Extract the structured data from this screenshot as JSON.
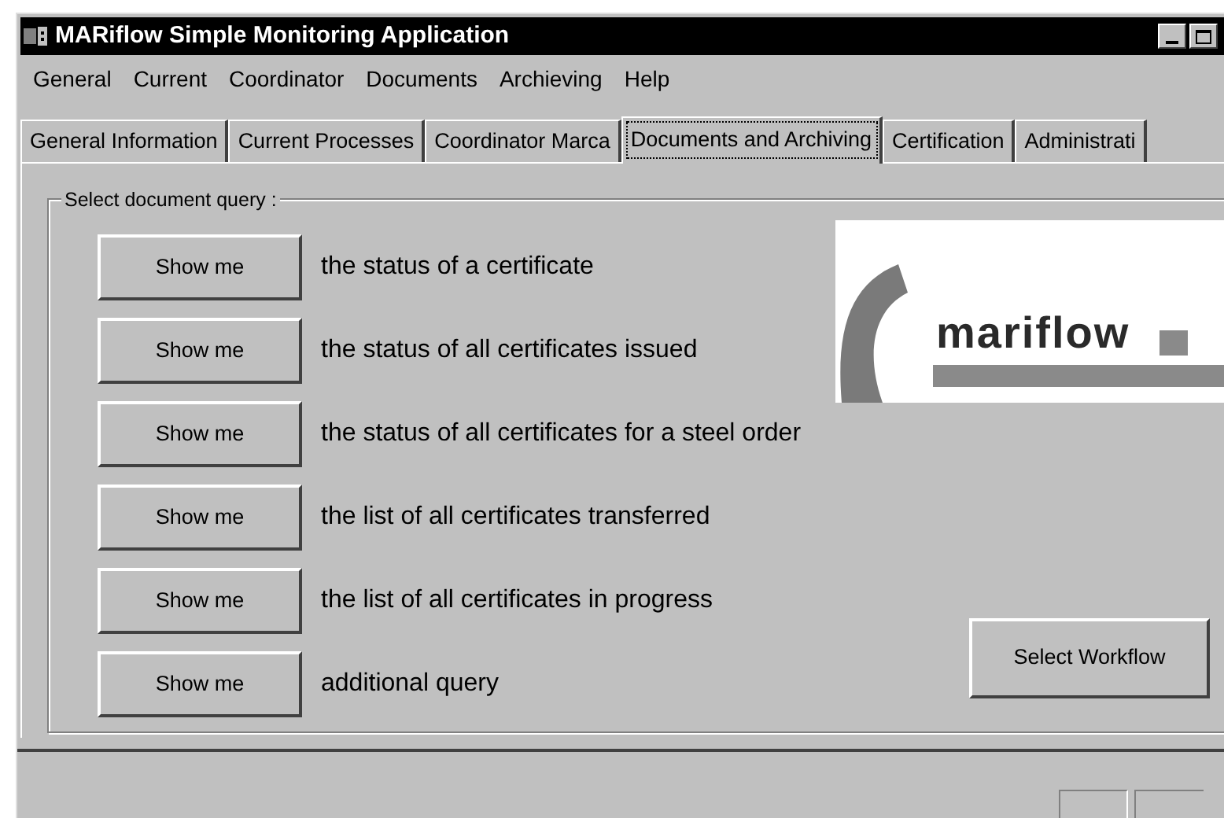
{
  "window": {
    "title": "MARiflow Simple Monitoring Application"
  },
  "menu": [
    "General",
    "Current",
    "Coordinator",
    "Documents",
    "Archieving",
    "Help"
  ],
  "tabs": [
    {
      "label": "General Information",
      "selected": false
    },
    {
      "label": "Current Processes",
      "selected": false
    },
    {
      "label": "Coordinator Marca",
      "selected": false
    },
    {
      "label": "Documents and Archiving",
      "selected": true
    },
    {
      "label": "Certification",
      "selected": false
    },
    {
      "label": "Administrati",
      "selected": false
    }
  ],
  "group": {
    "title": "Select document query :"
  },
  "queries": [
    {
      "button": "Show me",
      "text": "the status of a certificate"
    },
    {
      "button": "Show me",
      "text": "the status of all certificates issued"
    },
    {
      "button": "Show me",
      "text": "the status of all certificates for a steel order"
    },
    {
      "button": "Show me",
      "text": "the list of all certificates transferred"
    },
    {
      "button": "Show me",
      "text": "the list of all certificates in progress"
    },
    {
      "button": "Show me",
      "text": "additional query"
    }
  ],
  "logo": {
    "text": "mariflow"
  },
  "workflow_button": "Select Workflow"
}
